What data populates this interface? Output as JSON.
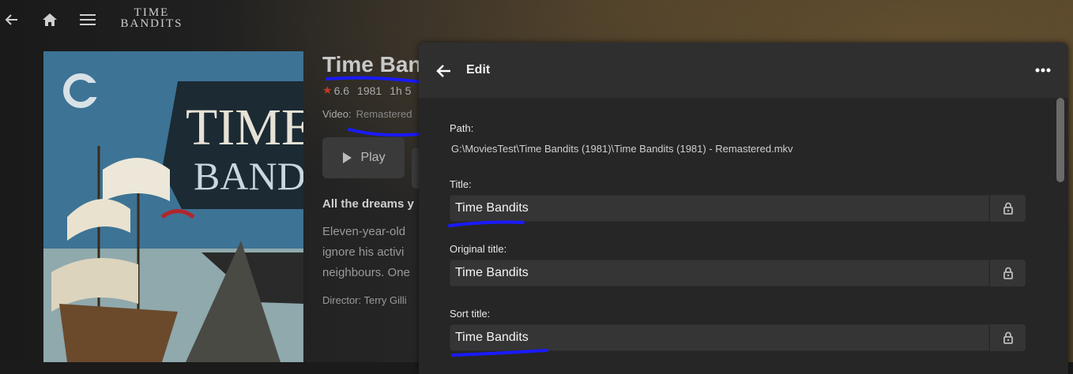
{
  "topbar": {
    "back_icon": "arrow-left-icon",
    "home_icon": "home-icon",
    "menu_icon": "hamburger-menu-icon",
    "logo_line1": "TIME",
    "logo_line2": "BANDITS"
  },
  "movie": {
    "title": "Time Bandits",
    "rating": "6.6",
    "year": "1981",
    "runtime": "1h 5",
    "video_label": "Video:",
    "video_value": "Remastered",
    "play_label": "Play",
    "tagline": "All the dreams y",
    "overview_lines": [
      "Eleven-year-old",
      "ignore his activi",
      "neighbours. One"
    ],
    "director": "Director: Terry Gilli",
    "poster_title_line1": "TIME",
    "poster_title_line2": "BANDITS"
  },
  "dialog": {
    "title": "Edit",
    "more_icon": "more-horizontal-icon",
    "path_label": "Path:",
    "path_value": "G:\\MoviesTest\\Time Bandits (1981)\\Time Bandits (1981) - Remastered.mkv",
    "fields": [
      {
        "label": "Title:",
        "value": "Time Bandits"
      },
      {
        "label": "Original title:",
        "value": "Time Bandits"
      },
      {
        "label": "Sort title:",
        "value": "Time Bandits"
      }
    ],
    "lock_icon": "lock-icon"
  },
  "colors": {
    "annotation": "#1a1aff",
    "star": "#c0392b",
    "dialog_bg": "#262626"
  }
}
